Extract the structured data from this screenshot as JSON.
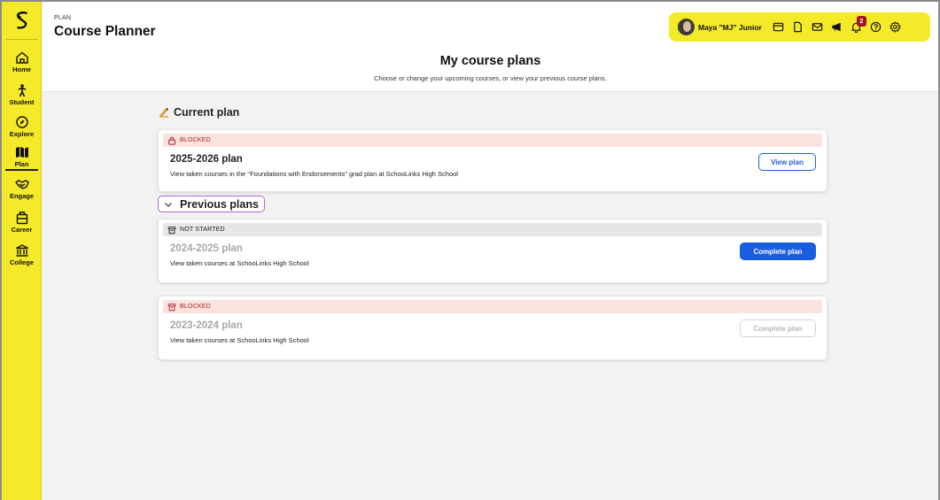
{
  "header": {
    "crumb": "PLAN",
    "title": "Course Planner",
    "user_name": "Maya \"MJ\" Junior",
    "notification_count": "2",
    "icons": [
      "wallet-icon",
      "document-icon",
      "mail-icon",
      "megaphone-icon",
      "bell-icon",
      "help-icon",
      "settings-icon"
    ]
  },
  "sidebar": {
    "items": [
      {
        "label": "Home",
        "icon": "home-icon"
      },
      {
        "label": "Student",
        "icon": "student-icon"
      },
      {
        "label": "Explore",
        "icon": "compass-icon"
      },
      {
        "label": "Plan",
        "icon": "map-icon"
      },
      {
        "label": "Engage",
        "icon": "handshake-icon"
      },
      {
        "label": "Career",
        "icon": "briefcase-icon"
      },
      {
        "label": "College",
        "icon": "college-icon"
      }
    ],
    "active": "Plan"
  },
  "page": {
    "title": "My course plans",
    "subtitle": "Choose or change your upcoming courses, or view your previous course plans."
  },
  "current": {
    "section_title": "Current plan",
    "cards": [
      {
        "status": "BLOCKED",
        "name": "2025-2026 plan",
        "description": "View taken courses in the \"Foundations with Endorsements\" grad plan at SchooLinks High School",
        "button": "View plan"
      }
    ]
  },
  "previous": {
    "section_title": "Previous plans",
    "cards": [
      {
        "status": "NOT STARTED",
        "name": "2024-2025 plan",
        "description": "View taken courses at SchooLinks High School",
        "button": "Complete plan"
      },
      {
        "status": "BLOCKED",
        "name": "2023-2024 plan",
        "description": "View taken courses at SchooLinks High School",
        "button": "Complete plan"
      }
    ]
  },
  "colors": {
    "brand_yellow": "#f5ea2a",
    "primary_blue": "#1a5ee0",
    "blocked_bg": "#fbe3dd",
    "blocked_text": "#a81e28",
    "notstarted_bg": "#e6e6e6",
    "badge_red": "#a01525",
    "toggle_border": "#b168d4"
  }
}
